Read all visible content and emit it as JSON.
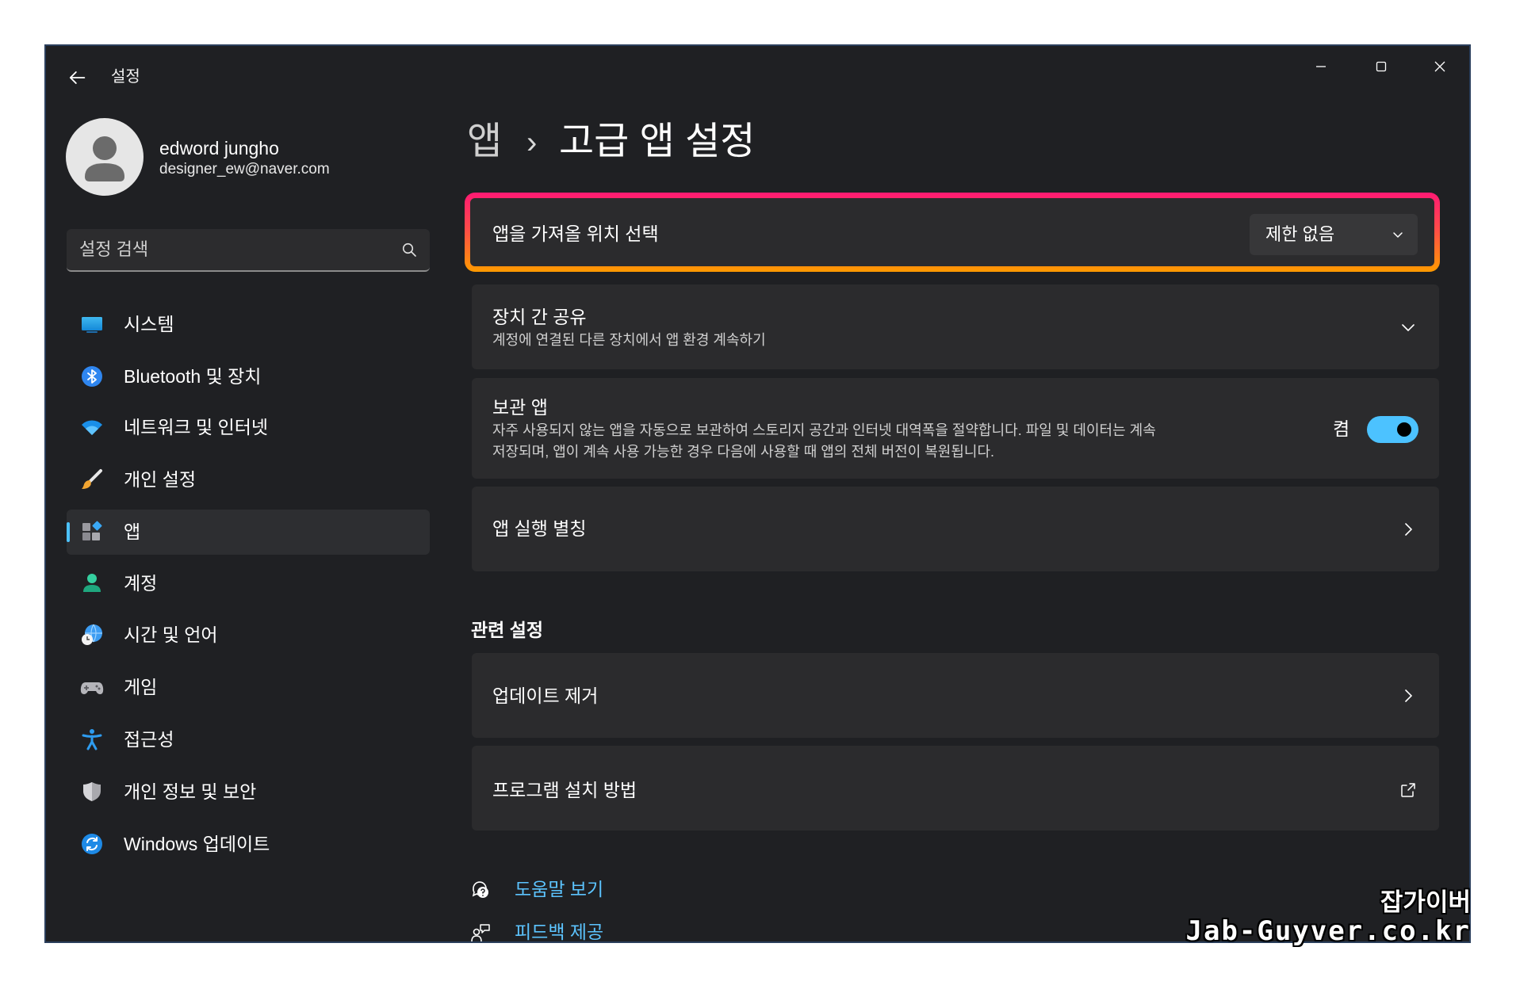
{
  "window": {
    "title": "설정",
    "controls": [
      "minimize-icon",
      "maximize-icon",
      "close-icon"
    ]
  },
  "profile": {
    "name": "edword jungho",
    "email": "designer_ew@naver.com"
  },
  "search": {
    "placeholder": "설정 검색",
    "icon": "search-icon"
  },
  "sidebar": {
    "selected_index": 4,
    "items": [
      {
        "label": "시스템",
        "icon": "system-icon"
      },
      {
        "label": "Bluetooth 및 장치",
        "icon": "bluetooth-icon"
      },
      {
        "label": "네트워크 및 인터넷",
        "icon": "network-icon"
      },
      {
        "label": "개인 설정",
        "icon": "personalization-brush-icon"
      },
      {
        "label": "앱",
        "icon": "apps-icon"
      },
      {
        "label": "계정",
        "icon": "account-icon"
      },
      {
        "label": "시간 및 언어",
        "icon": "time-language-icon"
      },
      {
        "label": "게임",
        "icon": "gaming-icon"
      },
      {
        "label": "접근성",
        "icon": "accessibility-icon"
      },
      {
        "label": "개인 정보 및 보안",
        "icon": "privacy-shield-icon"
      },
      {
        "label": "Windows 업데이트",
        "icon": "windows-update-icon"
      }
    ]
  },
  "breadcrumb": {
    "parent": "앱",
    "separator": "›",
    "current": "고급 앱 설정"
  },
  "settings": {
    "app_source": {
      "label": "앱을 가져올 위치 선택",
      "value": "제한 없음"
    },
    "share_across_devices": {
      "title": "장치 간 공유",
      "description": "계정에 연결된 다른 장치에서 앱 환경 계속하기"
    },
    "archive_apps": {
      "title": "보관 앱",
      "description_line1": "자주 사용되지 않는 앱을 자동으로 보관하여 스토리지 공간과 인터넷 대역폭을 절약합니다. 파일 및 데이터는 계속",
      "description_line2": "저장되며, 앱이 계속 사용 가능한 경우 다음에 사용할 때 앱의 전체 버전이 복원됩니다.",
      "state_label": "켬",
      "enabled": true
    },
    "app_execution_aliases": {
      "label": "앱 실행 별칭"
    }
  },
  "related": {
    "heading": "관련 설정",
    "items": [
      {
        "label": "업데이트 제거",
        "icon": "chevron-right-icon"
      },
      {
        "label": "프로그램 설치 방법",
        "icon": "external-link-icon"
      }
    ]
  },
  "help_links": [
    {
      "label": "도움말 보기",
      "icon": "help-icon"
    },
    {
      "label": "피드백 제공",
      "icon": "feedback-icon"
    }
  ],
  "watermark": {
    "line1": "잡가이버",
    "line2": "Jab-Guyver.co.kr"
  },
  "colors": {
    "accent": "#4cc2ff",
    "link": "#5cc4ff",
    "window_bg": "#1f2023",
    "card_bg": "#2b2b2d",
    "highlight_top": "#ff1a73",
    "highlight_bottom": "#ff9a00"
  }
}
